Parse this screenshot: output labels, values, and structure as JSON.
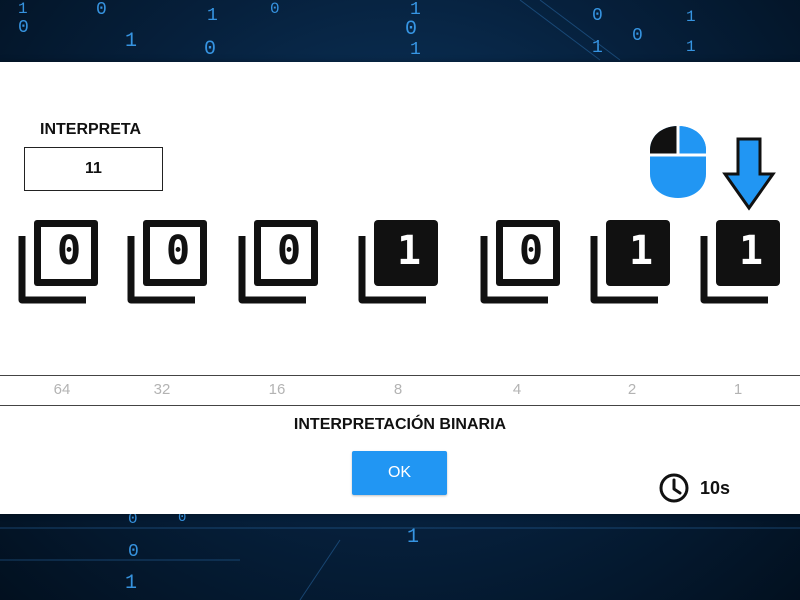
{
  "prompt": {
    "label": "INTERPRETA",
    "number": "11"
  },
  "bits": [
    {
      "value": "0",
      "on": false,
      "weight": "64"
    },
    {
      "value": "0",
      "on": false,
      "weight": "32"
    },
    {
      "value": "0",
      "on": false,
      "weight": "16"
    },
    {
      "value": "1",
      "on": true,
      "weight": "8"
    },
    {
      "value": "0",
      "on": false,
      "weight": "4"
    },
    {
      "value": "1",
      "on": true,
      "weight": "2"
    },
    {
      "value": "1",
      "on": true,
      "weight": "1"
    }
  ],
  "hint": {
    "mouse_icon": "mouse-left-click-icon",
    "arrow_icon": "arrow-down-icon",
    "arrow_target_weight": "1"
  },
  "result": {
    "title": "INTERPRETACIÓN BINARIA",
    "ok_label": "OK"
  },
  "timer": {
    "icon": "clock-icon",
    "text": "10s"
  },
  "background": {
    "binary_digits": [
      "1",
      "0",
      "0",
      "1",
      "0",
      "1",
      "0",
      "1",
      "0",
      "1",
      "0",
      "1",
      "1",
      "0",
      "1",
      "0",
      "1",
      "0",
      "1",
      "0"
    ]
  },
  "colors": {
    "accent": "#2196f3",
    "bit_on": "#111111",
    "bit_off_bg": "#ffffff",
    "weight_text": "#b3b3b3",
    "background": "#06203c"
  }
}
